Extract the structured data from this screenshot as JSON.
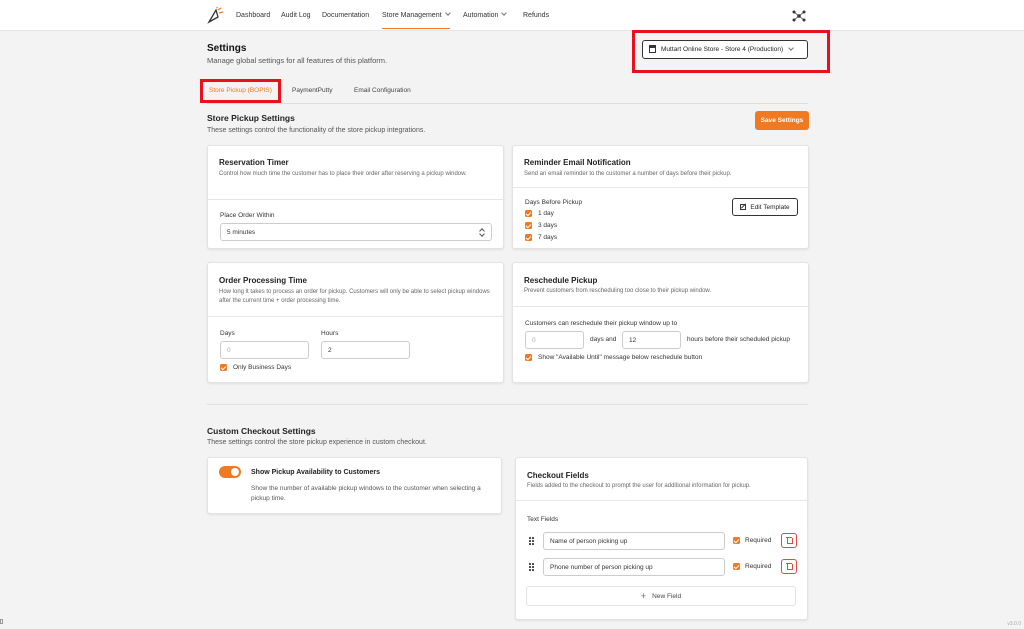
{
  "nav": {
    "items": [
      {
        "label": "Dashboard"
      },
      {
        "label": "Audit Log"
      },
      {
        "label": "Documentation"
      },
      {
        "label": "Store Management"
      },
      {
        "label": "Automation"
      },
      {
        "label": "Refunds"
      }
    ]
  },
  "header": {
    "title": "Settings",
    "subtitle": "Manage global settings for all features of this platform.",
    "store_select": "Muttart Online Store - Store 4 (Production)"
  },
  "tabs": [
    {
      "label": "Store Pickup (BOPIS)"
    },
    {
      "label": "PaymentPutty"
    },
    {
      "label": "Email Configuration"
    }
  ],
  "store_pickup": {
    "title": "Store Pickup Settings",
    "subtitle": "These settings control the functionality of the store pickup integrations.",
    "save_label": "Save Settings"
  },
  "reservation": {
    "title": "Reservation Timer",
    "desc": "Control how much time the customer has to place their order after reserving a pickup window.",
    "field_label": "Place Order Within",
    "value": "5 minutes"
  },
  "reminder": {
    "title": "Reminder Email Notification",
    "desc": "Send an email reminder to the customer a number of days before their pickup.",
    "days_label": "Days Before Pickup",
    "options": [
      "1 day",
      "3 days",
      "7 days"
    ],
    "edit_label": "Edit Template"
  },
  "processing": {
    "title": "Order Processing Time",
    "desc": "How long it takes to process an order for pickup. Customers will only be able to select pickup windows after the current time + order processing time.",
    "days_label": "Days",
    "days_placeholder": "0",
    "hours_label": "Hours",
    "hours_value": "2",
    "business_days_label": "Only Business Days"
  },
  "reschedule": {
    "title": "Reschedule Pickup",
    "desc": "Prevent customers from rescheduling too close to their pickup window.",
    "lead_label": "Customers can reschedule their pickup window up to",
    "days_placeholder": "0",
    "days_and": "days and",
    "hours_value": "12",
    "hours_suffix": "hours before their scheduled pickup",
    "available_label": "Show \"Available Until\" message below reschedule button"
  },
  "custom_checkout": {
    "title": "Custom Checkout Settings",
    "subtitle": "These settings control the store pickup experience in custom checkout."
  },
  "availability": {
    "title": "Show Pickup Availability to Customers",
    "desc": "Show the number of available pickup windows to the customer when selecting a pickup time."
  },
  "checkout_fields": {
    "title": "Checkout Fields",
    "desc": "Fields added to the checkout to prompt the user for additional information for pickup.",
    "text_fields_label": "Text Fields",
    "fields": [
      {
        "value": "Name of person picking up",
        "required_label": "Required"
      },
      {
        "value": "Phone number of person picking up",
        "required_label": "Required"
      }
    ],
    "new_field_label": "New Field"
  },
  "version": "v3.0.0",
  "colors": {
    "accent": "#f07a22",
    "highlight": "#e8111b"
  }
}
